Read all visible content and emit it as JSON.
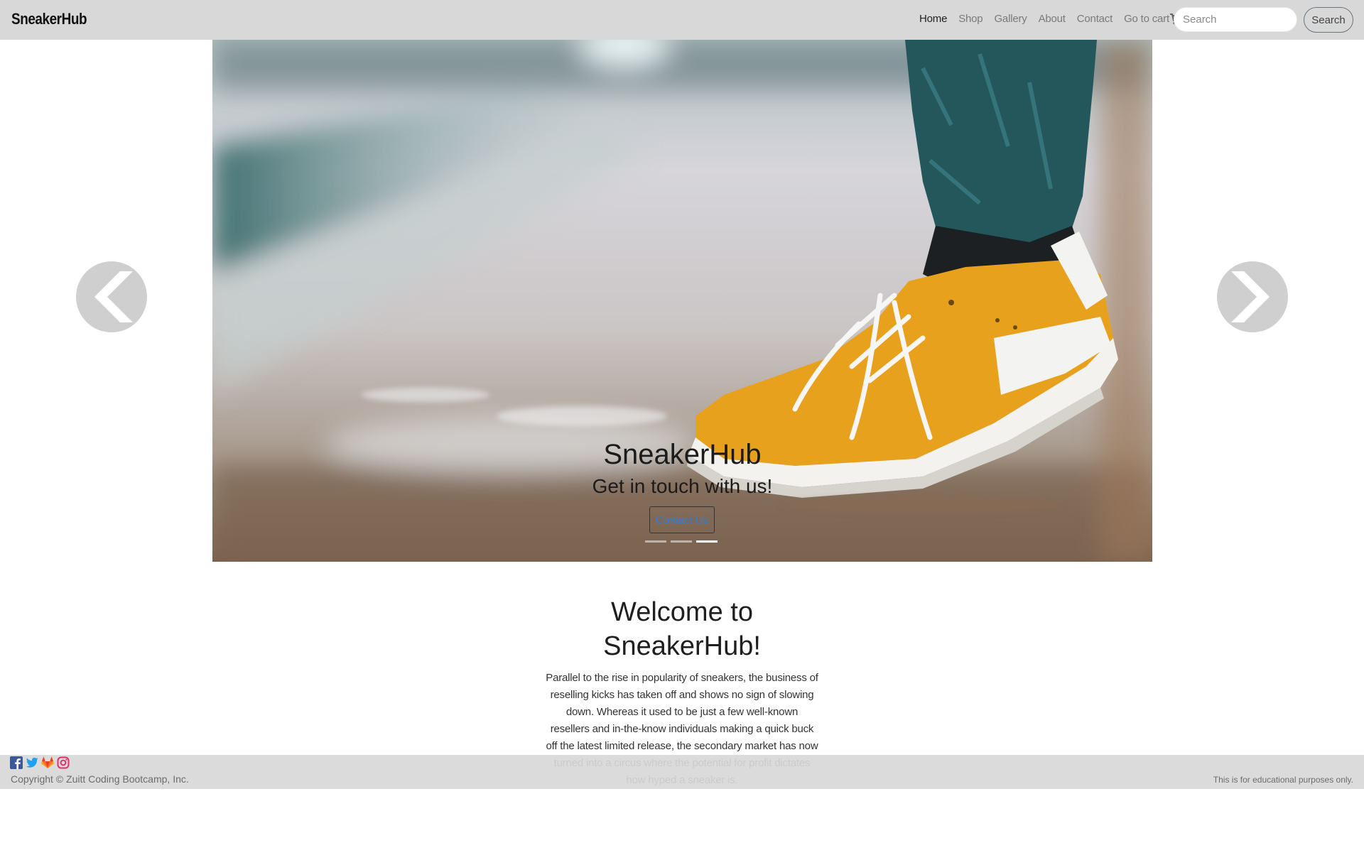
{
  "navbar": {
    "brand": "SneakerHub",
    "links": [
      "Home",
      "Shop",
      "Gallery",
      "About",
      "Contact",
      "Go to cart"
    ],
    "active_link": "Home",
    "search": {
      "placeholder": "Search",
      "button": "Search"
    }
  },
  "carousel": {
    "title": "SneakerHub",
    "subtitle": "Get in touch with us!",
    "button": "Contact Us",
    "slides_count": 3,
    "active_slide": 3,
    "prev_icon": "chevron-left-icon",
    "next_icon": "chevron-right-icon"
  },
  "welcome": {
    "title": "Welcome to SneakerHub!",
    "text": "Parallel to the rise in popularity of sneakers, the business of reselling kicks has taken off and shows no sign of slowing down. Whereas it used to be just a few well-known resellers and in-the-know individuals making a quick buck off the latest limited release, the secondary market has now turned into a circus where the potential for profit dictates how hyped a sneaker is."
  },
  "footer": {
    "social": [
      "facebook-icon",
      "twitter-icon",
      "gitlab-icon",
      "instagram-icon"
    ],
    "copyright": "Copyright © Zuitt Coding Bootcamp, Inc.",
    "disclaimer": "This is for educational purposes only."
  },
  "colors": {
    "navbar_bg": "#d8d8d8",
    "footer_bg": "#d8d8d8",
    "link_blue": "#2f7fd6",
    "shoe_orange": "#e6a21f"
  }
}
